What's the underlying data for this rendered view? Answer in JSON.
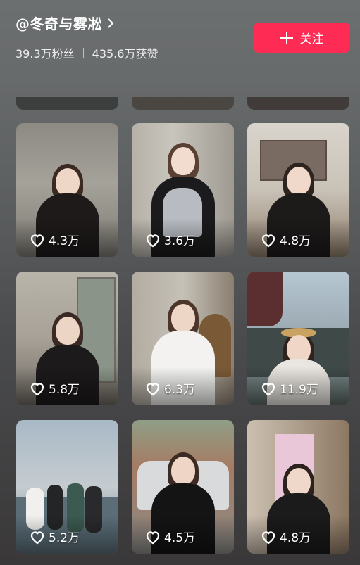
{
  "profile": {
    "name": "@冬奇与雾凇",
    "followers": "39.3万粉丝",
    "likes_total": "435.6万获赞",
    "follow_label": "关注"
  },
  "colors": {
    "accent": "#fe2c55",
    "background": "#5f6263"
  },
  "icons": {
    "follow": "plus-icon",
    "chevron": "chevron-right-icon",
    "like": "heart-outline-icon"
  },
  "videos": [
    {
      "likes": "4.3万"
    },
    {
      "likes": "3.6万"
    },
    {
      "likes": "4.8万"
    },
    {
      "likes": "5.8万"
    },
    {
      "likes": "6.3万"
    },
    {
      "likes": "11.9万"
    },
    {
      "likes": "5.2万"
    },
    {
      "likes": "4.5万"
    },
    {
      "likes": "4.8万"
    }
  ]
}
